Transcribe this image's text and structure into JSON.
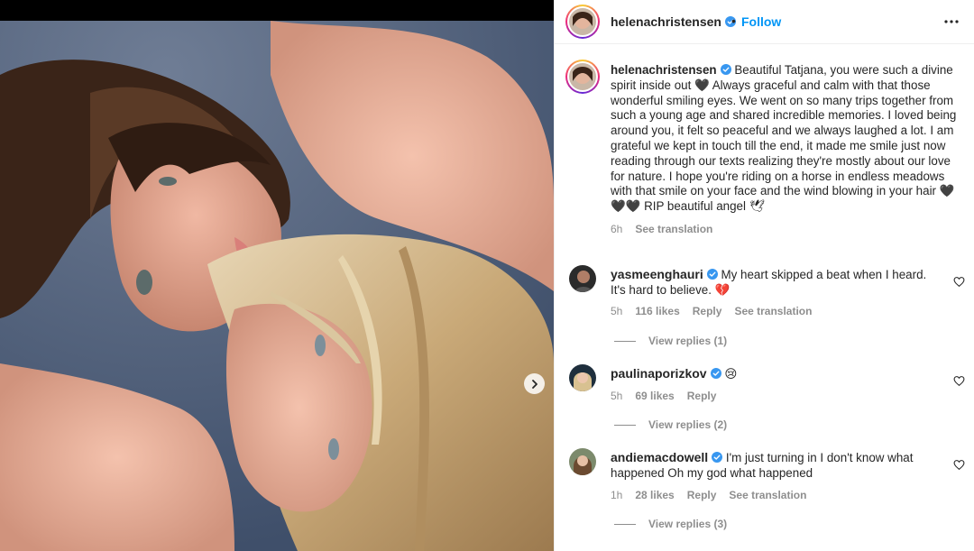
{
  "post": {
    "author": "helenachristensen",
    "follow_label": "Follow",
    "dot": "•",
    "caption": "Beautiful Tatjana, you were such a divine spirit inside out 🖤 Always graceful and calm with that those wonderful smiling eyes. We went on so many trips together from such a young age and shared incredible memories. I loved being around you, it felt so peaceful and we always laughed a lot. I am grateful we kept in touch till the end, it made me smile just now reading through our texts realizing they're mostly about our love for nature. I hope you're riding on a horse in endless meadows with that smile on your face and the wind blowing in your hair 🖤🖤🖤 RIP beautiful angel 🕊",
    "time": "6h",
    "see_translation": "See translation"
  },
  "comments": [
    {
      "username": "yasmeenghauri",
      "verified": true,
      "text": "My heart skipped a beat when I heard. It's hard to believe. 💔",
      "time": "5h",
      "likes": "116 likes",
      "reply": "Reply",
      "see_translation": "See translation",
      "view_replies": "View replies (1)"
    },
    {
      "username": "paulinaporizkov",
      "verified": true,
      "text": "😢",
      "time": "5h",
      "likes": "69 likes",
      "reply": "Reply",
      "view_replies": "View replies (2)"
    },
    {
      "username": "andiemacdowell",
      "verified": true,
      "text": "I'm just turning in I don't know what happened Oh my god what happened",
      "time": "1h",
      "likes": "28 likes",
      "reply": "Reply",
      "see_translation": "See translation",
      "view_replies": "View replies (3)"
    }
  ],
  "colors": {
    "link": "#0095f6",
    "verified": "#3897f0",
    "muted": "#8e8e8e",
    "text": "#262626"
  },
  "icons": [
    "verified-badge-icon",
    "more-options-icon",
    "heart-icon",
    "chevron-right-icon"
  ]
}
